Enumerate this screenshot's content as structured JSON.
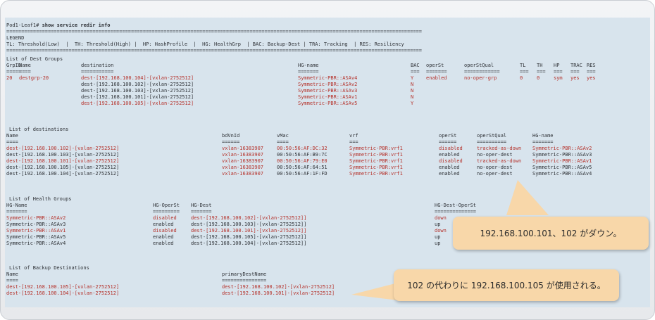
{
  "prompt": "Pod1-Leaf1#",
  "command": "show service redir info",
  "separator": "============================================================================================================================================",
  "legend": {
    "title": "LEGEND",
    "text": "TL: Threshold(Low)  |  TH: Threshold(High) |  HP: HashProfile  |  HG: HealthGrp  | BAC: Backup-Dest | TRA: Tracking  | RES: Resiliency"
  },
  "dest_groups": {
    "title": "List of Dest Groups",
    "headers": [
      "GrpID",
      "Name",
      "destination",
      "HG-name",
      "BAC",
      "operSt",
      "operStQual",
      "TL",
      "TH",
      "HP",
      "TRAC",
      "RES"
    ],
    "underlines": [
      "=====",
      "====",
      "===========",
      "=======",
      "===",
      "=======",
      "============",
      "===",
      "===",
      "===",
      "===",
      "==="
    ],
    "row": {
      "grpid": "20",
      "name": "destgrp-20",
      "operst": "enabled",
      "operstqual": "no-oper-grp",
      "tl": "0",
      "th": "0",
      "hp": "sym",
      "trac": "yes",
      "res": "yes",
      "dests": [
        {
          "dest": "dest-[192.168.100.104]-[vxlan-2752512]",
          "hg": "Symmetric-PBR::ASAv4",
          "bac": "Y",
          "red": true
        },
        {
          "dest": "dest-[192.168.100.102]-[vxlan-2752512]",
          "hg": "Symmetric-PBR::ASAv2",
          "bac": "N",
          "red": false
        },
        {
          "dest": "dest-[192.168.100.103]-[vxlan-2752512]",
          "hg": "Symmetric-PBR::ASAv3",
          "bac": "N",
          "red": false
        },
        {
          "dest": "dest-[192.168.100.101]-[vxlan-2752512]",
          "hg": "Symmetric-PBR::ASAv1",
          "bac": "N",
          "red": false
        },
        {
          "dest": "dest-[192.168.100.105]-[vxlan-2752512]",
          "hg": "Symmetric-PBR::ASAv5",
          "bac": "Y",
          "red": true
        }
      ]
    }
  },
  "destinations": {
    "title": "List of destinations",
    "headers": [
      "Name",
      "bdVnId",
      "vMac",
      "vrf",
      "operSt",
      "operStQual",
      "HG-name"
    ],
    "underlines": [
      "====",
      "======",
      "====",
      "===",
      "======",
      "==========",
      "======="
    ],
    "rows": [
      {
        "name": "dest-[192.168.100.102]-[vxlan-2752512]",
        "bd": "vxlan-16383907",
        "vmac": "00:50:56:AF:DC:32",
        "vrf": "Symmetric-PBR:vrf1",
        "operst": "disabled",
        "qual": "tracked-as-down",
        "hg": "Symmetric-PBR::ASAv2",
        "red": true
      },
      {
        "name": "dest-[192.168.100.103]-[vxlan-2752512]",
        "bd": "vxlan-16383907",
        "vmac": "00:50:56:AF:B9:7C",
        "vrf": "Symmetric-PBR:vrf1",
        "operst": "enabled",
        "qual": "no-oper-dest",
        "hg": "Symmetric-PBR::ASAv3",
        "red": false
      },
      {
        "name": "dest-[192.168.100.101]-[vxlan-2752512]",
        "bd": "vxlan-16383907",
        "vmac": "00:50:56:AF:79:E0",
        "vrf": "Symmetric-PBR:vrf1",
        "operst": "disabled",
        "qual": "tracked-as-down",
        "hg": "Symmetric-PBR::ASAv1",
        "red": true
      },
      {
        "name": "dest-[192.168.100.105]-[vxlan-2752512]",
        "bd": "vxlan-16383907",
        "vmac": "00:50:56:AF:64:51",
        "vrf": "Symmetric-PBR:vrf1",
        "operst": "enabled",
        "qual": "no-oper-dest",
        "hg": "Symmetric-PBR::ASAv5",
        "red": false
      },
      {
        "name": "dest-[192.168.100.104]-[vxlan-2752512]",
        "bd": "vxlan-16383907",
        "vmac": "00:50:56:AF:1F:FD",
        "vrf": "Symmetric-PBR:vrf1",
        "operst": "enabled",
        "qual": "no-oper-dest",
        "hg": "Symmetric-PBR::ASAv4",
        "red": false
      }
    ]
  },
  "health_groups": {
    "title": "List of Health Groups",
    "headers": [
      "HG-Name",
      "HG-OperSt",
      "HG-Dest",
      "HG-Dest-OperSt"
    ],
    "underlines": [
      "=======",
      "=========",
      "=======",
      "=============="
    ],
    "rows": [
      {
        "name": "Symmetric-PBR::ASAv2",
        "operst": "disabled",
        "dest": "dest-[192.168.100.102]-[vxlan-2752512]]",
        "destop": "down",
        "red": true
      },
      {
        "name": "Symmetric-PBR::ASAv3",
        "operst": "enabled",
        "dest": "dest-[192.168.100.103]-[vxlan-2752512]]",
        "destop": "up",
        "red": false
      },
      {
        "name": "Symmetric-PBR::ASAv1",
        "operst": "disabled",
        "dest": "dest-[192.168.100.101]-[vxlan-2752512]]",
        "destop": "down",
        "red": true
      },
      {
        "name": "Symmetric-PBR::ASAv5",
        "operst": "enabled",
        "dest": "dest-[192.168.100.105]-[vxlan-2752512]]",
        "destop": "up",
        "red": false
      },
      {
        "name": "Symmetric-PBR::ASAv4",
        "operst": "enabled",
        "dest": "dest-[192.168.100.104]-[vxlan-2752512]]",
        "destop": "up",
        "red": false
      }
    ]
  },
  "backup": {
    "title": "List of Backup Destinations",
    "headers": [
      "Name",
      "primaryDestName"
    ],
    "underlines": [
      "====",
      "==============="
    ],
    "rows": [
      {
        "name": "dest-[192.168.100.105]-[vxlan-2752512]",
        "primary": "dest-[192.168.100.102]-[vxlan-2752512]"
      },
      {
        "name": "dest-[192.168.100.104]-[vxlan-2752512]",
        "primary": "dest-[192.168.100.101]-[vxlan-2752512]"
      }
    ]
  },
  "callouts": {
    "down": "192.168.100.101、102 がダウン。",
    "backup": "102 の代わりに 192.168.100.105 が使用される。"
  },
  "colors": {
    "terminal_bg": "#d8e4ed",
    "text": "#2e3136",
    "highlight": "#b5312a",
    "callout_bg": "#f8d7a9"
  }
}
